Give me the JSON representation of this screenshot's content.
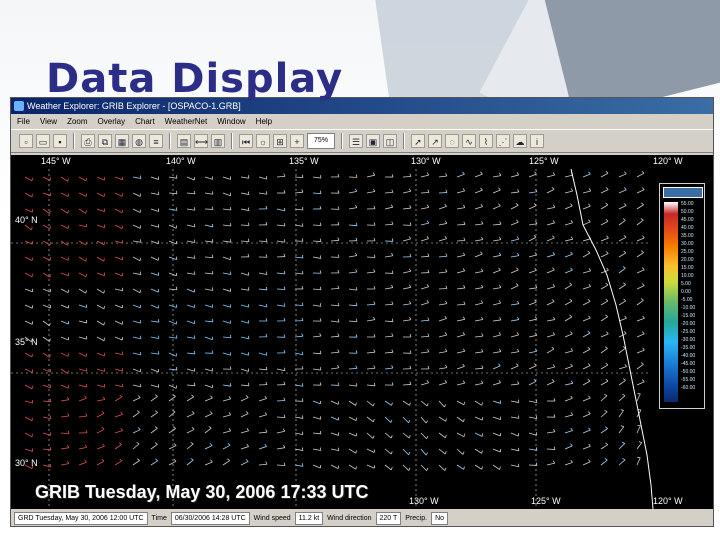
{
  "slide": {
    "title": "Data Display"
  },
  "window": {
    "title": "Weather Explorer: GRIB Explorer - [OSPACO-1.GRB]",
    "menu": [
      "File",
      "View",
      "Zoom",
      "Overlay",
      "Chart",
      "WeatherNet",
      "Window",
      "Help"
    ],
    "zoom_value": "75%"
  },
  "map": {
    "lon_labels_top": [
      "145° W",
      "140° W",
      "135° W",
      "130° W",
      "125° W",
      "120° W"
    ],
    "lat_labels": [
      "40° N",
      "35° N",
      "30° N"
    ],
    "lon_labels_bottom": [
      "130° W",
      "125° W",
      "120° W"
    ],
    "overlay_text": "GRIB Tuesday, May 30, 2006 17:33 UTC",
    "legend_ticks": [
      "55.00",
      "50.00",
      "45.00",
      "40.00",
      "35.00",
      "30.00",
      "25.00",
      "20.00",
      "15.00",
      "10.00",
      "5.00",
      "0.00",
      "-5.00",
      "-10.00",
      "-15.00",
      "-20.00",
      "-25.00",
      "-30.00",
      "-35.00",
      "-40.00",
      "-45.00",
      "-50.00",
      "-55.00",
      "-60.00"
    ]
  },
  "statusbar": {
    "datetime": "GRD Tuesday, May 30, 2006 12:00 UTC",
    "time_label": "Time",
    "time_value": "06/30/2006 14:28 UTC",
    "wind_speed_label": "Wind speed",
    "wind_speed_value": "11.2 kt",
    "wind_dir_label": "Wind direction",
    "wind_dir_value": "220 T",
    "precip_label": "Precip.",
    "precip_value": "No"
  },
  "colors": {
    "title": "#2b2d86",
    "map_bg": "#000000",
    "titlebar": "#0a246a"
  }
}
